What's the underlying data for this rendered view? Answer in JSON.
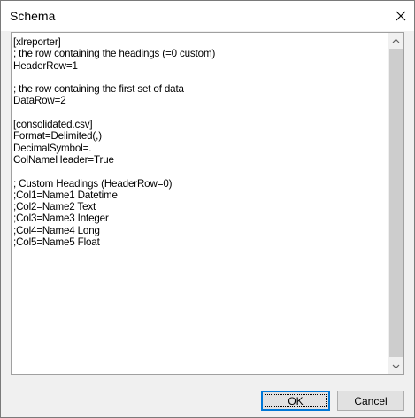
{
  "window": {
    "title": "Schema"
  },
  "editor": {
    "lines": [
      "[xlreporter]",
      "; the row containing the headings (=0 custom)",
      "HeaderRow=1",
      "",
      "; the row containing the first set of data",
      "DataRow=2",
      "",
      "[consolidated.csv]",
      "Format=Delimited(,)",
      "DecimalSymbol=.",
      "ColNameHeader=True",
      "",
      "; Custom Headings (HeaderRow=0)",
      ";Col1=Name1 Datetime",
      ";Col2=Name2 Text",
      ";Col3=Name3 Integer",
      ";Col4=Name4 Long",
      ";Col5=Name5 Float"
    ]
  },
  "buttons": {
    "ok_label": "OK",
    "cancel_label": "Cancel"
  },
  "icons": {
    "close": "close-icon",
    "scroll_up": "chevron-up-icon",
    "scroll_down": "chevron-down-icon"
  },
  "colors": {
    "accent": "#0078d7"
  }
}
